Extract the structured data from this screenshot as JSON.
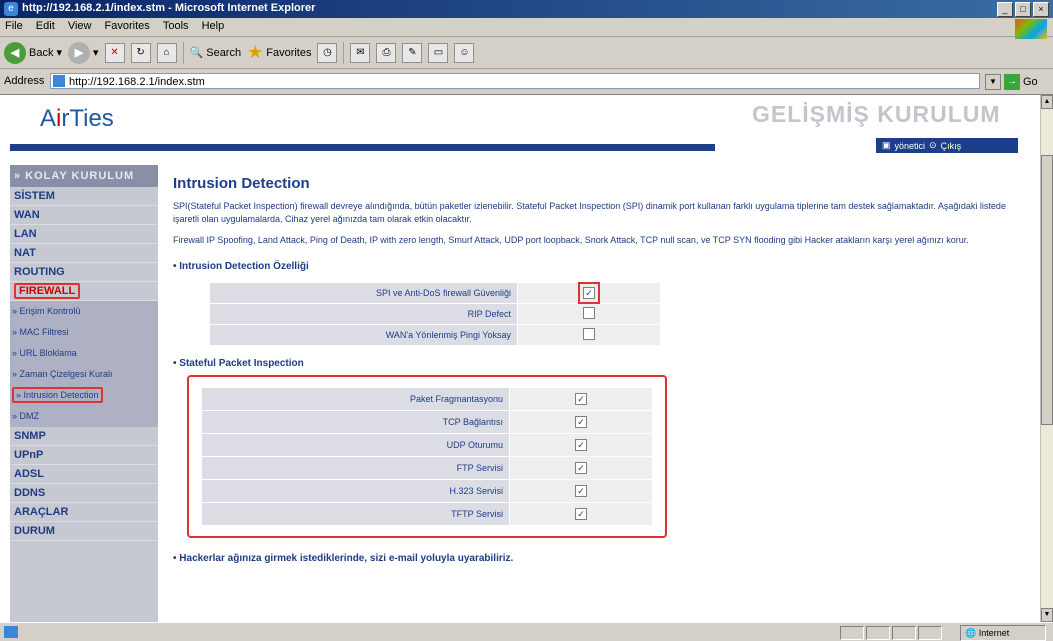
{
  "window": {
    "title": "http://192.168.2.1/index.stm - Microsoft Internet Explorer"
  },
  "menu": [
    "File",
    "Edit",
    "View",
    "Favorites",
    "Tools",
    "Help"
  ],
  "toolbar": {
    "back": "Back",
    "search": "Search",
    "favorites": "Favorites"
  },
  "address": {
    "label": "Address",
    "url": "http://192.168.2.1/index.stm",
    "go": "Go"
  },
  "header": {
    "logo_a": "A",
    "logo_i": "i",
    "logo_rest": "rTies",
    "title": "GELİŞMİŞ KURULUM",
    "user": "yönetici",
    "exit": "Çıkış"
  },
  "sidebar": {
    "head": "» KOLAY KURULUM",
    "items_top": [
      "SİSTEM",
      "WAN",
      "LAN",
      "NAT",
      "ROUTING"
    ],
    "firewall": "FIREWALL",
    "subs": [
      "» Erişim Kontrolü",
      "» MAC Filtresi",
      "» URL Bloklama",
      "» Zaman Çizelgesi Kuralı",
      "» Intrusion Detection",
      "» DMZ"
    ],
    "items_bottom": [
      "SNMP",
      "UPnP",
      "ADSL",
      "DDNS",
      "ARAÇLAR",
      "DURUM"
    ]
  },
  "main": {
    "title": "Intrusion Detection",
    "p1": "SPI(Stateful Packet Inspection) firewall devreye alındığında, bütün paketler izlenebilir. Stateful Packet Inspection (SPI) dinamik port kullanan farklı uygulama tiplerine tam destek sağlamaktadır. Aşağıdaki listede işaretli olan uygulamalarda, Cihaz yerel ağınızda tam olarak etkin olacaktır.",
    "p2": "Firewall IP Spoofing, Land Attack, Ping of Death, IP with zero length, Smurf Attack, UDP port loopback, Snork Attack, TCP null scan, ve TCP SYN flooding gibi Hacker atakların karşı yerel ağınızı korur.",
    "sec1": "• Intrusion Detection Özelliği",
    "ids_rows": [
      {
        "label": "SPI ve Anti-DoS firewall Güvenliği",
        "checked": true
      },
      {
        "label": "RIP Defect",
        "checked": false
      },
      {
        "label": "WAN'a Yönlenmiş Pingi Yoksay",
        "checked": false
      }
    ],
    "sec2": "• Stateful Packet Inspection",
    "spi_rows": [
      {
        "label": "Paket Fragmantasyonu",
        "checked": true
      },
      {
        "label": "TCP Bağlantısı",
        "checked": true
      },
      {
        "label": "UDP Oturumu",
        "checked": true
      },
      {
        "label": "FTP Servisi",
        "checked": true
      },
      {
        "label": "H.323 Servisi",
        "checked": true
      },
      {
        "label": "TFTP Servisi",
        "checked": true
      }
    ],
    "sec3": "• Hackerlar ağınıza girmek istediklerinde, sizi e-mail yoluyla uyarabiliriz."
  },
  "status": {
    "zone": "Internet"
  }
}
